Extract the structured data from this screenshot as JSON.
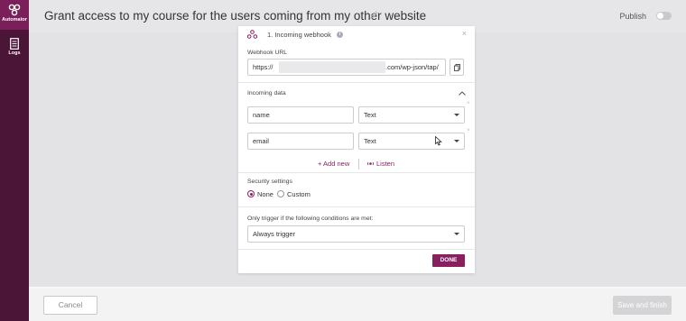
{
  "sidebar": {
    "items": [
      {
        "label": "Automator",
        "icon": "automator-logo-icon"
      },
      {
        "label": "Logs",
        "icon": "logs-icon"
      }
    ]
  },
  "header": {
    "title": "Grant access to my course for the users coming from my other website",
    "publish_label": "Publish"
  },
  "trigger_card": {
    "title": "1. Incoming webhook",
    "webhook_url_label": "Webhook URL",
    "webhook_url_prefix": "https://",
    "webhook_url_suffix": ".com/wp-json/tap/",
    "incoming_data_label": "Incoming data",
    "fields": [
      {
        "key": "name",
        "type": "Text"
      },
      {
        "key": "email",
        "type": "Text"
      }
    ],
    "add_new_label": "+ Add new",
    "listen_label": "Listen",
    "security_label": "Security settings",
    "security_options": [
      {
        "label": "None",
        "selected": true
      },
      {
        "label": "Custom",
        "selected": false
      }
    ],
    "conditions_label": "Only trigger if the following conditions are met:",
    "conditions_value": "Always trigger",
    "done_label": "DONE"
  },
  "footer": {
    "cancel_label": "Cancel",
    "save_label": "Save and finish"
  },
  "colors": {
    "brand": "#8a1f5f",
    "sidebar": "#4b1538"
  }
}
